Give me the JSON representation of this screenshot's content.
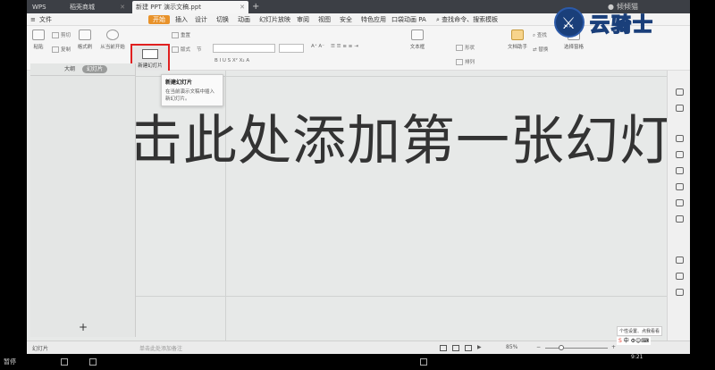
{
  "window": {
    "tabs": [
      {
        "label": "WPS"
      },
      {
        "label": "稻壳商城"
      },
      {
        "label": "新建 PPT 演示文稿.ppt"
      }
    ],
    "user_name": "倾倾猫"
  },
  "menubar": {
    "file": "文件",
    "items": [
      "开始",
      "插入",
      "设计",
      "切换",
      "动画",
      "幻灯片放映",
      "审阅",
      "视图",
      "安全",
      "特色应用",
      "口袋动画 PA"
    ],
    "search": "查找命令、搜索模板"
  },
  "ribbon": {
    "paste": "粘贴",
    "cut": "剪切",
    "copy": "复制",
    "format_painter": "格式刷",
    "play_from_current": "从当前开始",
    "new_slide": "新建幻灯片",
    "layout": "版式",
    "section": "节",
    "reset": "重置",
    "text_box": "文本框",
    "shape": "形状",
    "arrange": "排列",
    "doc_assistant": "文档助手",
    "find": "查找",
    "replace": "替换",
    "select_pane": "选择窗格"
  },
  "tooltip": {
    "title": "新建幻灯片",
    "description": "在当前演示文稿中插入新幻灯片。"
  },
  "left_panel": {
    "tab_outline": "大纲",
    "tab_slides": "幻灯片"
  },
  "slide": {
    "title_placeholder": "击此处添加第一张幻灯"
  },
  "statusbar": {
    "slide_label": "幻灯片",
    "notes_placeholder": "单击此处添加备注",
    "zoom": "85%"
  },
  "ime": {
    "tip": "个性设置、点我看看",
    "label": "中"
  },
  "taskbar": {
    "status": "暂停",
    "time": "9:21"
  },
  "watermark": {
    "text": "云骑士"
  }
}
